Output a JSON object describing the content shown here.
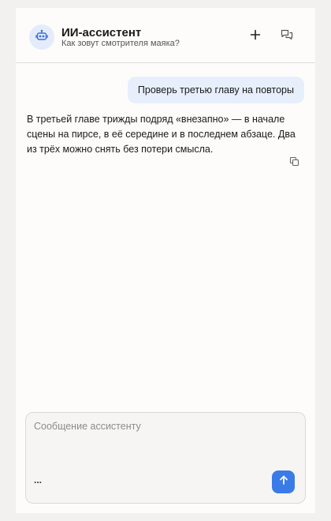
{
  "header": {
    "title": "ИИ-ассистент",
    "subtitle": "Как зовут смотрителя маяка?",
    "avatar_icon": "robot-icon",
    "new_chat_icon": "plus-icon",
    "history_icon": "chat-history-icon"
  },
  "messages": [
    {
      "role": "user",
      "text": "Проверь третью главу на повторы"
    },
    {
      "role": "assistant",
      "text": "В третьей главе трижды подряд «внезапно» — в начале сцены на пирсе, в её середине и в последнем абзаце. Два из трёх можно снять без потери смысла.",
      "copy_icon": "copy-icon"
    }
  ],
  "composer": {
    "placeholder": "Сообщение ассистенту",
    "value": "",
    "more_label": "...",
    "send_icon": "arrow-up-icon"
  },
  "colors": {
    "accent": "#3b7be8",
    "user_bubble": "#e7effc",
    "avatar_bg": "#e4ecfb"
  }
}
